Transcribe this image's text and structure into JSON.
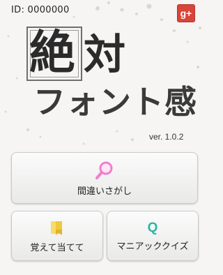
{
  "top_bar": {
    "id_label": "ID: 0000000",
    "gplus_label": "g+"
  },
  "logo": {
    "kanji_boxed": "絶",
    "kanji_plain": "対",
    "line2": "フォント感",
    "version": "ver. 1.0.2"
  },
  "menu": {
    "main": {
      "label": "間違いさがし",
      "icon": "magnifier-icon"
    },
    "left": {
      "label": "覚えて当てて",
      "icon": "flag-icon"
    },
    "right": {
      "label": "マニアッククイズ",
      "icon": "q-icon",
      "icon_text": "Q"
    }
  },
  "colors": {
    "gplus_bg": "#d8453a",
    "magnifier": "#f07ecd",
    "flag": "#f0c93a",
    "q": "#2ab6a2"
  }
}
